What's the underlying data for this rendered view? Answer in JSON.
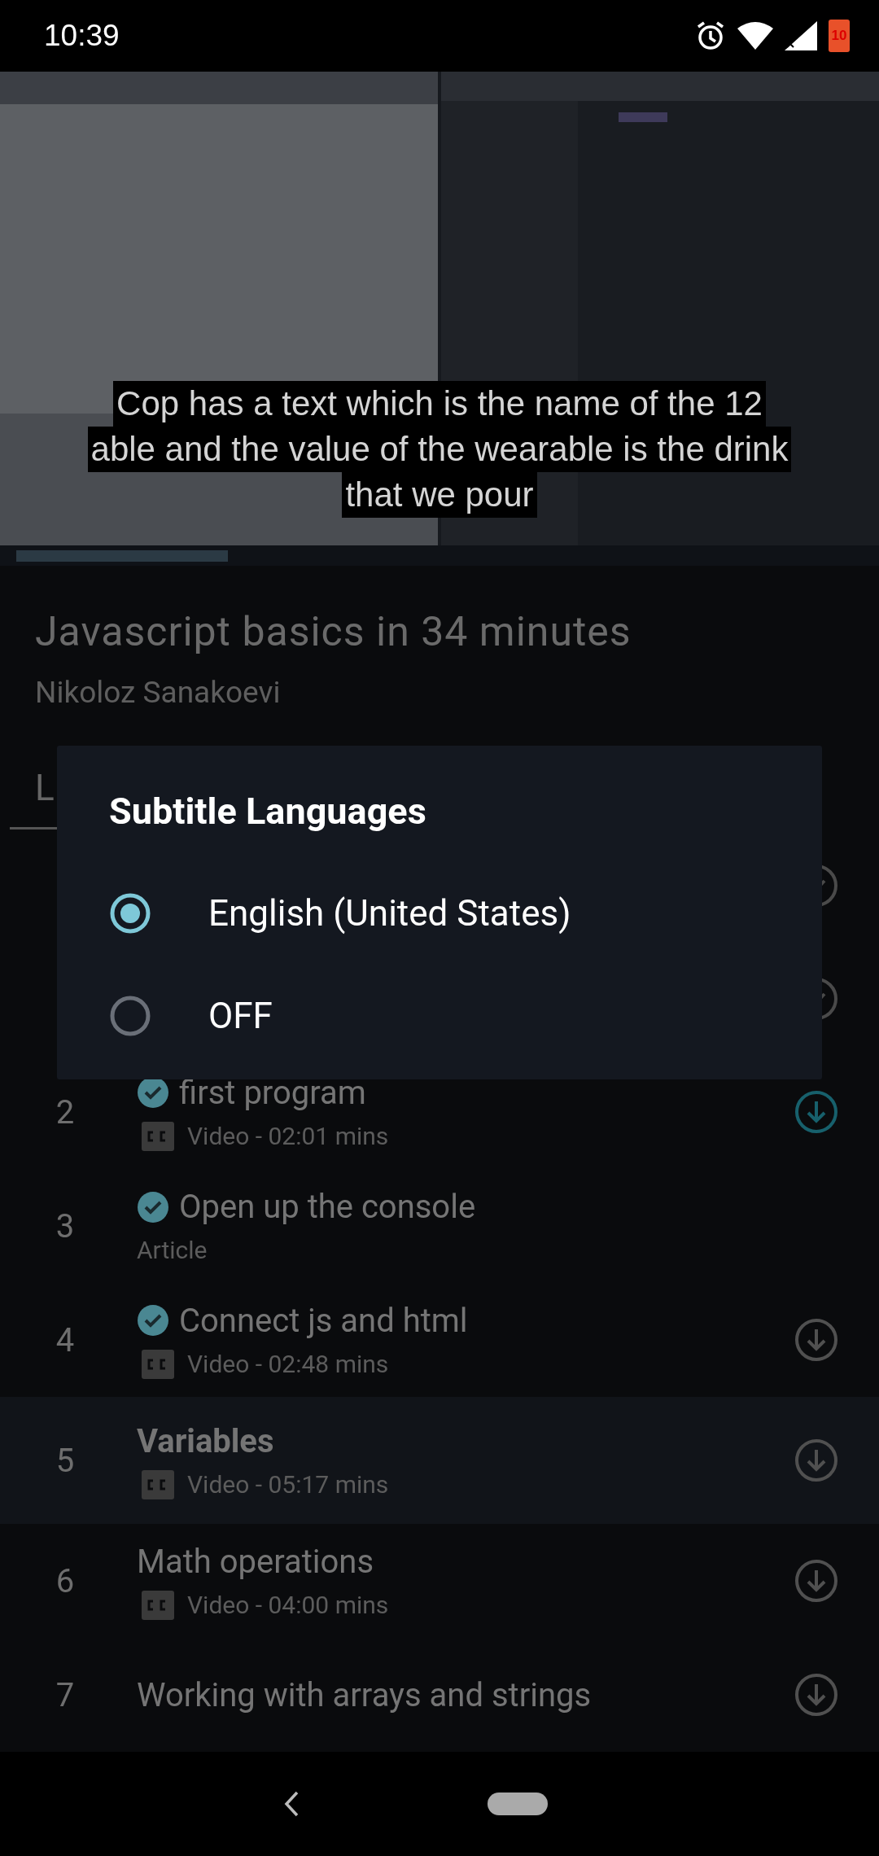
{
  "status_bar": {
    "time": "10:39",
    "battery": "10"
  },
  "video": {
    "kind": "picture",
    "subtitle_lines": [
      "Cop has a text which is the name of the 12",
      "able and the value of the wearable is the drink",
      "that we pour"
    ]
  },
  "course": {
    "title": "Javascript basics in 34 minutes",
    "author": "Nikoloz Sanakoevi"
  },
  "tabs": [
    {
      "label": "L",
      "selected": true
    }
  ],
  "covered_rows": [
    {
      "completed": true
    },
    {
      "completed": true
    }
  ],
  "lessons": [
    {
      "number": "2",
      "title": "first program",
      "completed": true,
      "kind": "video",
      "meta": "Video - 02:01 mins",
      "downloadable": true,
      "downloaded": true,
      "current": false
    },
    {
      "number": "3",
      "title": "Open up the console",
      "completed": true,
      "kind": "article",
      "meta": "Article",
      "downloadable": false,
      "current": false
    },
    {
      "number": "4",
      "title": "Connect js and html",
      "completed": true,
      "kind": "video",
      "meta": "Video - 02:48 mins",
      "downloadable": true,
      "downloaded": false,
      "current": false
    },
    {
      "number": "5",
      "title": "Variables",
      "completed": false,
      "kind": "video",
      "meta": "Video - 05:17 mins",
      "downloadable": true,
      "downloaded": false,
      "current": true
    },
    {
      "number": "6",
      "title": "Math operations",
      "completed": false,
      "kind": "video",
      "meta": "Video - 04:00 mins",
      "downloadable": true,
      "downloaded": false,
      "current": false
    },
    {
      "number": "7",
      "title": "Working with arrays and strings",
      "completed": false,
      "kind": "title_only",
      "downloadable": true,
      "downloaded": false,
      "current": false
    }
  ],
  "dialog": {
    "title": "Subtitle Languages",
    "options": [
      {
        "label": "English (United States)",
        "selected": true
      },
      {
        "label": "OFF",
        "selected": false
      }
    ]
  }
}
